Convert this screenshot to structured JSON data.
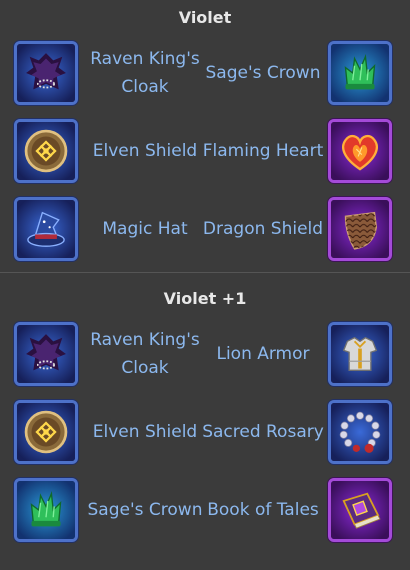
{
  "sections": [
    {
      "title": "Violet",
      "rows": [
        {
          "left": {
            "name": "Raven King's Cloak",
            "icon": "raven-cloak-icon",
            "rarity": "blue"
          },
          "right": {
            "name": "Sage's Crown",
            "icon": "sage-crown-icon",
            "rarity": "blue"
          }
        },
        {
          "left": {
            "name": "Elven Shield",
            "icon": "elven-shield-icon",
            "rarity": "blue"
          },
          "right": {
            "name": "Flaming Heart",
            "icon": "flaming-heart-icon",
            "rarity": "violet"
          }
        },
        {
          "left": {
            "name": "Magic Hat",
            "icon": "magic-hat-icon",
            "rarity": "blue"
          },
          "right": {
            "name": "Dragon Shield",
            "icon": "dragon-shield-icon",
            "rarity": "violet"
          }
        }
      ]
    },
    {
      "title": "Violet +1",
      "rows": [
        {
          "left": {
            "name": "Raven King's Cloak",
            "icon": "raven-cloak-icon",
            "rarity": "blue"
          },
          "right": {
            "name": "Lion Armor",
            "icon": "lion-armor-icon",
            "rarity": "blue"
          }
        },
        {
          "left": {
            "name": "Elven Shield",
            "icon": "elven-shield-icon",
            "rarity": "blue"
          },
          "right": {
            "name": "Sacred Rosary",
            "icon": "sacred-rosary-icon",
            "rarity": "blue"
          }
        },
        {
          "left": {
            "name": "Sage's Crown",
            "icon": "sage-crown-icon",
            "rarity": "blue"
          },
          "right": {
            "name": "Book of Tales",
            "icon": "book-of-tales-icon",
            "rarity": "violet"
          }
        }
      ]
    }
  ],
  "colors": {
    "background": "#3b3b3b",
    "title": "#e8e8e8",
    "item_label": "#8cb8ee",
    "blue_frame": "#4d71c9",
    "violet_frame": "#a44ad8"
  }
}
